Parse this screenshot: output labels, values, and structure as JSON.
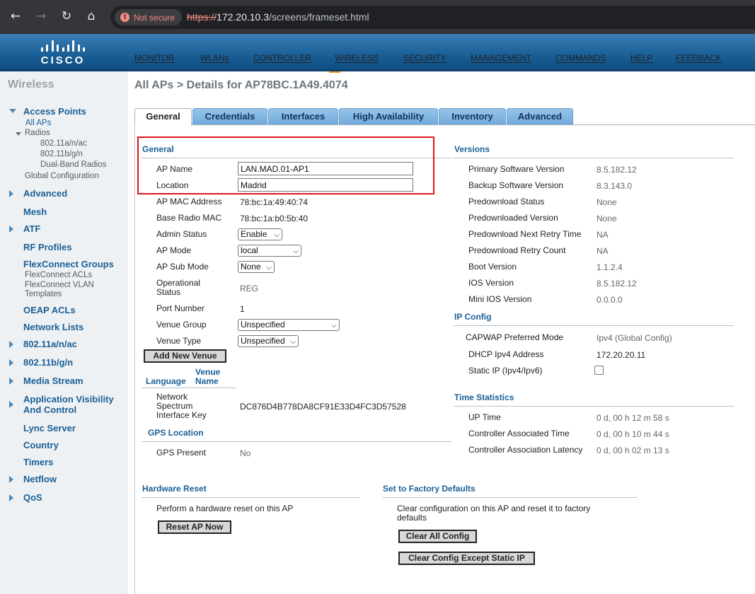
{
  "browser": {
    "secure_label": "Not secure",
    "url_protocol": "https://",
    "url_host": "172.20.10.3",
    "url_path": "/screens/frameset.html"
  },
  "topnav": [
    "MONITOR",
    "WLANs",
    "CONTROLLER",
    "WIRELESS",
    "SECURITY",
    "MANAGEMENT",
    "COMMANDS",
    "HELP",
    "FEEDBACK"
  ],
  "topnav_active": "WIRELESS",
  "logo_text": "CISCO",
  "sidebar": {
    "title": "Wireless",
    "access_points": "Access Points",
    "all_aps": "All APs",
    "radios": "Radios",
    "radio_a": "802.11a/n/ac",
    "radio_b": "802.11b/g/n",
    "dual_band": "Dual-Band Radios",
    "global_config": "Global Configuration",
    "advanced": "Advanced",
    "mesh": "Mesh",
    "atf": "ATF",
    "rf_profiles": "RF Profiles",
    "flexconnect_groups": "FlexConnect Groups",
    "flexconnect_acls": "FlexConnect ACLs",
    "flexconnect_vlan_1": "FlexConnect VLAN",
    "flexconnect_vlan_2": "Templates",
    "oeap_acls": "OEAP ACLs",
    "network_lists": "Network Lists",
    "band_a": "802.11a/n/ac",
    "band_b": "802.11b/g/n",
    "media_stream": "Media Stream",
    "app_visibility_1": "Application Visibility",
    "app_visibility_2": "And Control",
    "lync_server": "Lync Server",
    "country": "Country",
    "timers": "Timers",
    "netflow": "Netflow",
    "qos": "QoS"
  },
  "breadcrumb": "All APs > Details for AP78BC.1A49.4074",
  "tabs": [
    "General",
    "Credentials",
    "Interfaces",
    "High Availability",
    "Inventory",
    "Advanced"
  ],
  "general": {
    "section_title": "General",
    "ap_name_label": "AP Name",
    "ap_name_value": "LAN.MAD.01-AP1",
    "location_label": "Location",
    "location_value": "Madrid",
    "mac_label": "AP MAC Address",
    "mac_value": "78:bc:1a:49:40:74",
    "radio_mac_label": "Base Radio MAC",
    "radio_mac_value": "78:bc:1a:b0:5b:40",
    "admin_status_label": "Admin Status",
    "admin_status_value": "Enable",
    "ap_mode_label": "AP Mode",
    "ap_mode_value": "local",
    "ap_submode_label": "AP Sub Mode",
    "ap_submode_value": "None",
    "op_status_label_1": "Operational",
    "op_status_label_2": "Status",
    "op_status_value": "REG",
    "port_label": "Port Number",
    "port_value": "1",
    "venue_group_label": "Venue Group",
    "venue_group_value": "Unspecified",
    "venue_type_label": "Venue Type",
    "venue_type_value": "Unspecified",
    "add_venue_button": "Add New Venue",
    "col_language": "Language",
    "col_venue_1": "Venue",
    "col_venue_2": "Name",
    "nsi_label_1": "Network",
    "nsi_label_2": "Spectrum",
    "nsi_label_3": "Interface Key",
    "nsi_value": "DC876D4B778DA8CF91E33D4FC3D57528"
  },
  "gps": {
    "section_title": "GPS Location",
    "present_label": "GPS Present",
    "present_value": "No"
  },
  "versions": {
    "section_title": "Versions",
    "rows": [
      {
        "label": "Primary Software Version",
        "value": "8.5.182.12"
      },
      {
        "label": "Backup Software Version",
        "value": "8.3.143.0"
      },
      {
        "label": "Predownload Status",
        "value": "None"
      },
      {
        "label": "Predownloaded Version",
        "value": "None"
      },
      {
        "label": "Predownload Next Retry Time",
        "value": "NA"
      },
      {
        "label": "Predownload Retry Count",
        "value": "NA"
      },
      {
        "label": "Boot Version",
        "value": "1.1.2.4"
      },
      {
        "label": "IOS Version",
        "value": "8.5.182.12"
      },
      {
        "label": "Mini IOS Version",
        "value": "0.0.0.0"
      }
    ]
  },
  "ip_config": {
    "section_title": "IP Config",
    "capwap_label": "CAPWAP Preferred Mode",
    "capwap_value": "Ipv4 (Global Config)",
    "dhcp_label": "DHCP Ipv4 Address",
    "dhcp_value": "172.20.20.11",
    "static_label": "Static IP (Ipv4/Ipv6)"
  },
  "time_stats": {
    "section_title": "Time Statistics",
    "rows": [
      {
        "label": "UP Time",
        "value": "0 d, 00 h 12 m 58 s"
      },
      {
        "label": "Controller Associated Time",
        "value": "0 d, 00 h 10 m 44 s"
      },
      {
        "label": "Controller Association Latency",
        "value": "0 d, 00 h 02 m 13 s"
      }
    ]
  },
  "hardware_reset": {
    "section_title": "Hardware Reset",
    "description": "Perform a hardware reset on this AP",
    "button": "Reset AP Now"
  },
  "factory_defaults": {
    "section_title": "Set to Factory Defaults",
    "description_1": "Clear configuration on this AP and reset it to factory",
    "description_2": "defaults",
    "clear_all_button": "Clear All Config",
    "clear_except_button": "Clear Config Except Static IP"
  },
  "colors": {
    "header_blue": "#1a5f96",
    "active_tab_underline": "#f0a01c",
    "highlight_red": "#e01818"
  }
}
